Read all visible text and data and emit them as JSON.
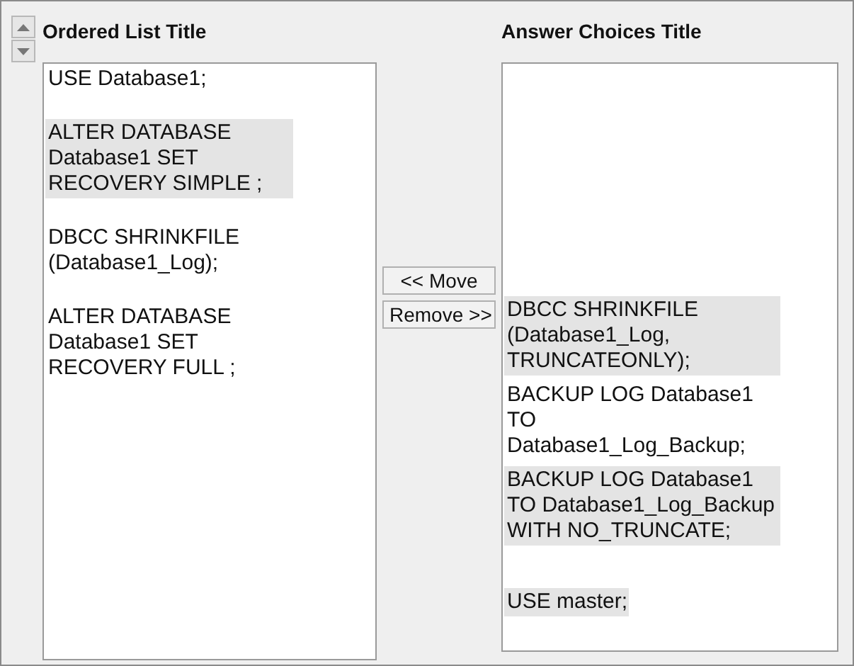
{
  "ordered_list": {
    "title": "Ordered List Title",
    "items": [
      {
        "text": "USE Database1;",
        "shaded": false
      },
      {
        "text": "ALTER DATABASE Database1 SET RECOVERY SIMPLE ;",
        "shaded": true
      },
      {
        "text": "DBCC SHRINKFILE (Database1_Log);",
        "shaded": false
      },
      {
        "text": "ALTER DATABASE Database1 SET RECOVERY FULL ;",
        "shaded": false
      }
    ]
  },
  "buttons": [
    "<< Move",
    "Remove >>"
  ],
  "answer_choices": {
    "title": "Answer Choices Title",
    "items": [
      {
        "text": "DBCC SHRINKFILE (Database1_Log, TRUNCATEONLY);",
        "shaded": true
      },
      {
        "text": "BACKUP LOG Database1 TO Database1_Log_Backup;",
        "shaded": false
      },
      {
        "text": "BACKUP LOG Database1 TO Database1_Log_Backup WITH NO_TRUNCATE;",
        "shaded": true
      },
      {
        "text": "USE master;",
        "shaded": true
      }
    ]
  }
}
